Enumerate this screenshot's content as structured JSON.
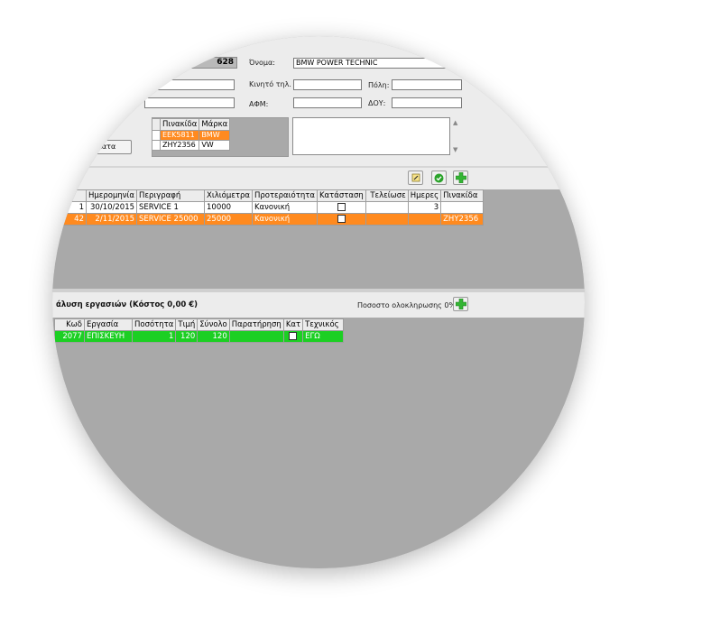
{
  "customer": {
    "number": "628",
    "name_label": "Όνομα:",
    "name_value": "BMW POWER TECHNIC",
    "mobile_label": "Κινητό τηλ.",
    "city_label": "Πόλη:",
    "afm_label": "ΑΦΜ:",
    "doy_label": "ΔΟΥ:",
    "vehicles_button": "ματα"
  },
  "plates": {
    "headers": [
      "Πινακίδα",
      "Μάρκα"
    ],
    "rows": [
      [
        "EEK5811",
        "BMW"
      ],
      [
        "ZHY2356",
        "VW"
      ]
    ]
  },
  "services": {
    "headers": [
      "Ημερομηνία",
      "Περιγραφή",
      "Χιλιόμετρα",
      "Προτεραιότητα",
      "Κατάσταση",
      "Τελείωσε",
      "Ημερες",
      "Πινακίδα"
    ],
    "rows": [
      {
        "id": "1",
        "date": "30/10/2015",
        "desc": "SERVICE 1",
        "km": "10000",
        "priority": "Κανονική",
        "days": "3",
        "plate": ""
      },
      {
        "id": "42",
        "date": "2/11/2015",
        "desc": "SERVICE 25000",
        "km": "25000",
        "priority": "Κανονική",
        "days": "",
        "plate": "ZHY2356"
      }
    ]
  },
  "tasks": {
    "title": "άλυση εργασιών (Κόστος 0,00 €)",
    "completion": "Ποσοστο ολοκληρωσης 0%",
    "headers": [
      "Κωδ",
      "Εργασία",
      "Ποσότητα",
      "Τιμή",
      "Σύνολο",
      "Παρατήρηση",
      "Κατ",
      "Τεχνικός"
    ],
    "rows": [
      {
        "code": "2077",
        "task": "ΕΠΙΣΚΕΥΗ",
        "qty": "1",
        "price": "120",
        "total": "120",
        "note": "",
        "tech": "ΕΓΩ"
      }
    ]
  },
  "colors": {
    "selected_orange": "#ff8a1f",
    "done_green": "#1ccf23",
    "background_grey": "#a9a9a9"
  }
}
